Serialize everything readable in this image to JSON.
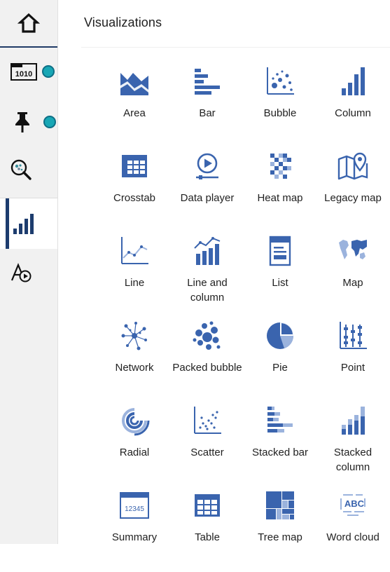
{
  "panel": {
    "title": "Visualizations"
  },
  "colors": {
    "icon": "#3a64ae",
    "icon_light": "#9bb3dd",
    "rail_bg": "#f1f1f1",
    "badge": "#18a7b5",
    "active_bar": "#1d3c6e"
  },
  "sidebar": {
    "items": [
      {
        "icon": "home-icon"
      },
      {
        "icon": "data-source-icon",
        "badge": true
      },
      {
        "icon": "pin-icon",
        "badge": true
      },
      {
        "icon": "search-icon"
      },
      {
        "icon": "visualizations-icon",
        "active": true
      },
      {
        "icon": "data-player-icon"
      }
    ]
  },
  "visualizations": [
    {
      "label": "Area",
      "icon": "area-icon"
    },
    {
      "label": "Bar",
      "icon": "bar-icon"
    },
    {
      "label": "Bubble",
      "icon": "bubble-icon"
    },
    {
      "label": "Column",
      "icon": "column-icon"
    },
    {
      "label": "Crosstab",
      "icon": "crosstab-icon"
    },
    {
      "label": "Data player",
      "icon": "data-player-icon"
    },
    {
      "label": "Heat map",
      "icon": "heat-map-icon"
    },
    {
      "label": "Legacy map",
      "icon": "legacy-map-icon"
    },
    {
      "label": "Line",
      "icon": "line-icon"
    },
    {
      "label": "Line and column",
      "icon": "line-and-column-icon"
    },
    {
      "label": "List",
      "icon": "list-icon"
    },
    {
      "label": "Map",
      "icon": "map-icon"
    },
    {
      "label": "Network",
      "icon": "network-icon"
    },
    {
      "label": "Packed bubble",
      "icon": "packed-bubble-icon"
    },
    {
      "label": "Pie",
      "icon": "pie-icon"
    },
    {
      "label": "Point",
      "icon": "point-icon"
    },
    {
      "label": "Radial",
      "icon": "radial-icon"
    },
    {
      "label": "Scatter",
      "icon": "scatter-icon"
    },
    {
      "label": "Stacked bar",
      "icon": "stacked-bar-icon"
    },
    {
      "label": "Stacked column",
      "icon": "stacked-column-icon"
    },
    {
      "label": "Summary",
      "icon": "summary-icon",
      "icon_text": "12345"
    },
    {
      "label": "Table",
      "icon": "table-icon"
    },
    {
      "label": "Tree map",
      "icon": "tree-map-icon"
    },
    {
      "label": "Word cloud",
      "icon": "word-cloud-icon",
      "icon_text": "ABC"
    }
  ]
}
